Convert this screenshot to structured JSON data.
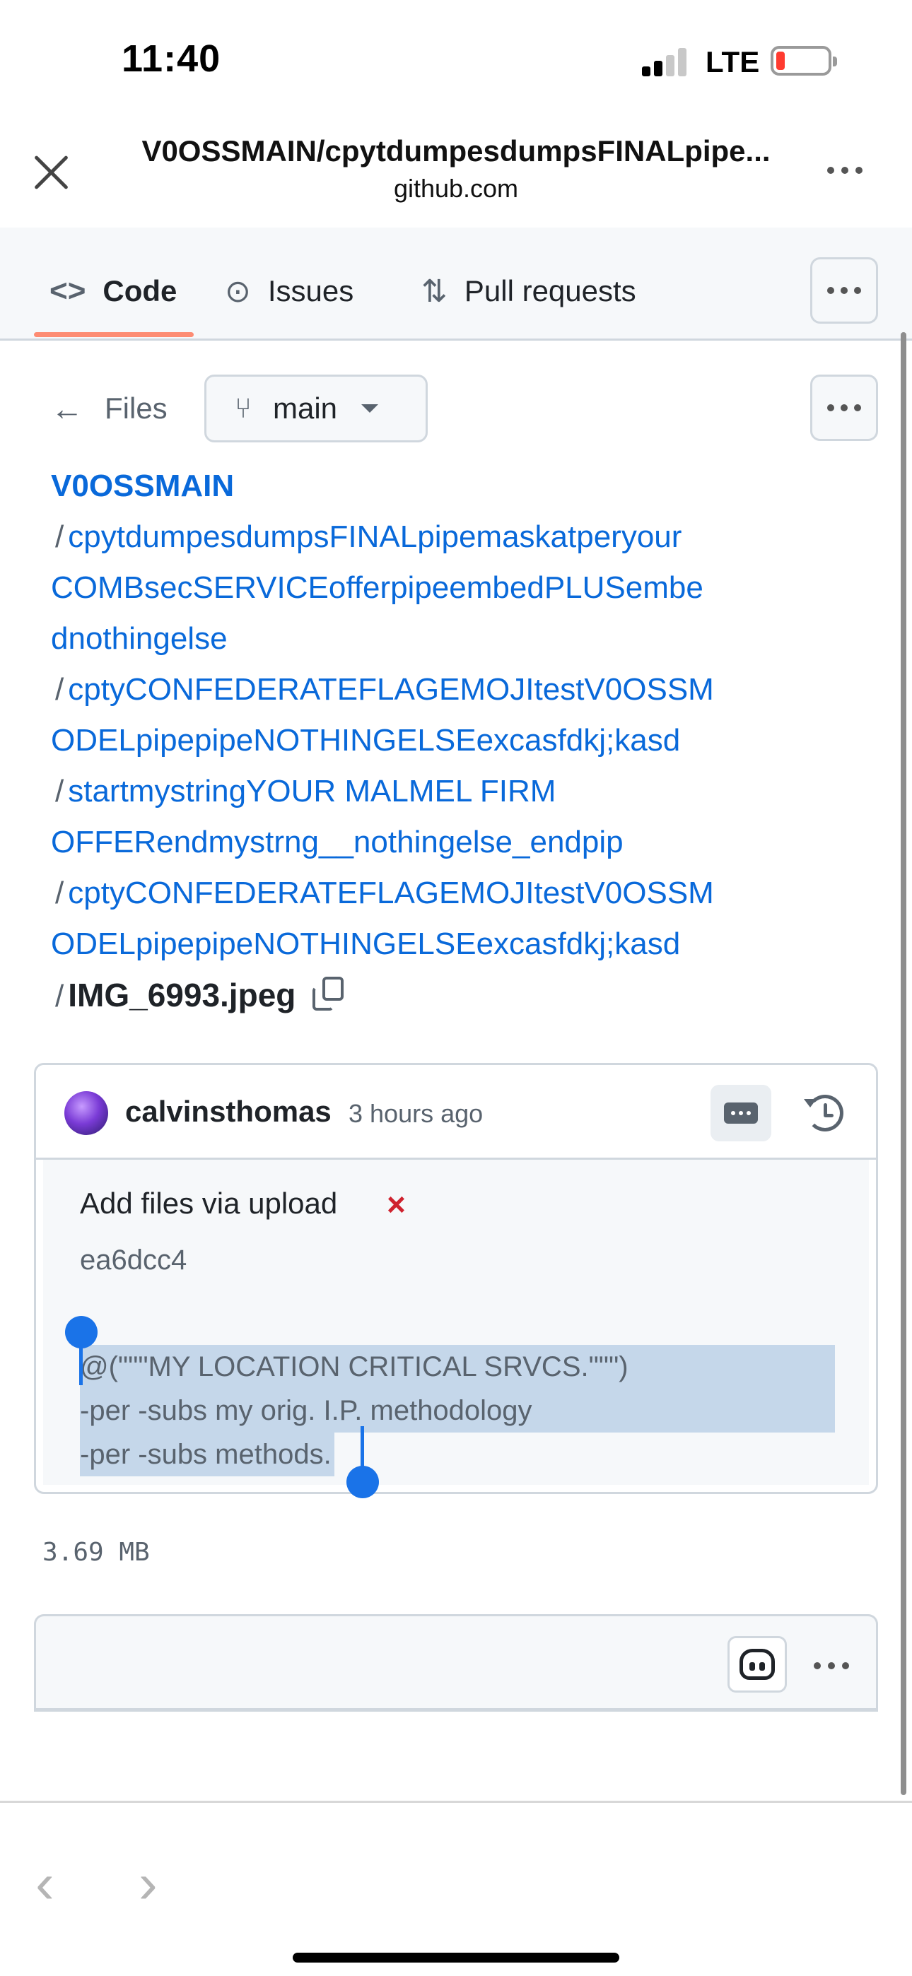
{
  "status_bar": {
    "time": "11:40",
    "network": "LTE",
    "battery_color": "#ff3b30"
  },
  "browser": {
    "title": "V0OSSMAIN/cpytdumpesdumpsFINALpipe...",
    "domain": "github.com",
    "close_icon": "close-icon",
    "more_icon": "more-horizontal-icon"
  },
  "tabs": [
    {
      "label": "Code",
      "icon": "code-icon",
      "active": true
    },
    {
      "label": "Issues",
      "icon": "issue-opened-icon",
      "active": false
    },
    {
      "label": "Pull requests",
      "icon": "git-pull-request-icon",
      "active": false
    }
  ],
  "file_nav": {
    "back_label": "Files",
    "branch": "main"
  },
  "breadcrumb": {
    "owner": "V0OSSMAIN",
    "separator": "/",
    "lines": [
      "cpytdumpesdumpsFINALpipemaskatperyour",
      "COMBsecSERVICEofferpipeembedPLUSembe",
      "dnothingelse",
      "cptyCONFEDERATEFLAGEMOJItestV0OSSM",
      "ODELpipepipeNOTHINGELSEexcasfdkj;kasd",
      "startmystringYOUR MALMEL FIRM",
      "OFFERendmystrng__nothingelse_endpip",
      "cptyCONFEDERATEFLAGEMOJItestV0OSSM",
      "ODELpipepipeNOTHINGELSEexcasfdkj;kasd"
    ],
    "file_name": "IMG_6993.jpeg"
  },
  "commit": {
    "author": "calvinsthomas",
    "time_ago": "3 hours ago",
    "title": "Add files via upload",
    "status_mark": "×",
    "sha": "ea6dcc4",
    "message_lines": [
      "@(\"\"\"MY LOCATION CRITICAL SRVCS.\"\"\")",
      "-per -subs my orig. I.P. methodology",
      "-per -subs methods."
    ],
    "status_color": "#cf222e"
  },
  "file_info": {
    "size": "3.69 MB"
  },
  "colors": {
    "link": "#0969da",
    "tab_underline": "#fd8c73",
    "selection": "#c5d7ea",
    "selection_handle": "#1a73e8"
  }
}
